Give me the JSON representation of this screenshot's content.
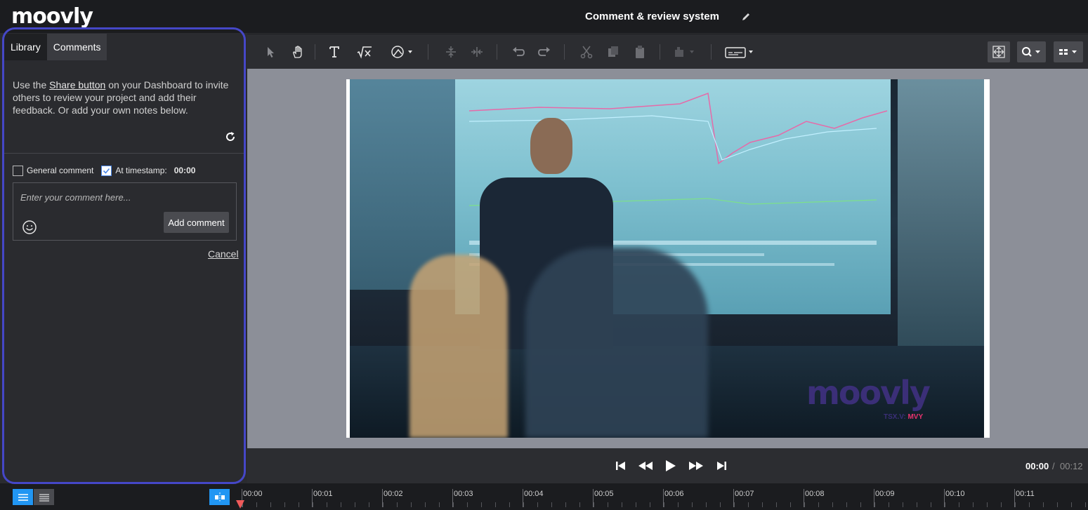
{
  "app": {
    "logo": "moovly",
    "project_title": "Comment & review system"
  },
  "left_panel": {
    "tabs": [
      {
        "label": "Library"
      },
      {
        "label": "Comments",
        "active": true
      }
    ],
    "help_prefix": "Use the ",
    "help_link": "Share button",
    "help_suffix": " on your Dashboard to invite others to review your project and add their feedback. Or add your own notes below.",
    "general_comment": {
      "label": "General comment",
      "checked": false
    },
    "at_timestamp": {
      "label": "At timestamp:",
      "checked": true,
      "value": "00:00"
    },
    "comment_placeholder": "Enter your comment here...",
    "add_comment_label": "Add comment",
    "cancel_label": "Cancel"
  },
  "toolbar": {
    "icons": [
      "select-icon",
      "hand-icon",
      "text-icon",
      "formula-icon",
      "shape-icon",
      "align-vertical-icon",
      "align-horizontal-icon",
      "undo-icon",
      "redo-icon",
      "cut-icon",
      "copy-icon",
      "paste-icon",
      "fill-icon",
      "caption-icon",
      "fit-screen-icon",
      "zoom-icon",
      "layout-icon"
    ]
  },
  "video": {
    "watermark": "moovly",
    "watermark_sub_prefix": "TSX.V: ",
    "watermark_sub_highlight": "MVY"
  },
  "playback": {
    "current_time": "00:00",
    "separator": "/",
    "total_time": "00:12"
  },
  "timeline": {
    "ticks": [
      "00:00",
      "00:01",
      "00:02",
      "00:03",
      "00:04",
      "00:05",
      "00:06",
      "00:07",
      "00:08",
      "00:09",
      "00:10",
      "00:11"
    ]
  },
  "colors": {
    "accent_outline": "#4547c7",
    "brand_pink": "#e9336f",
    "timeline_active": "#2196f3"
  }
}
